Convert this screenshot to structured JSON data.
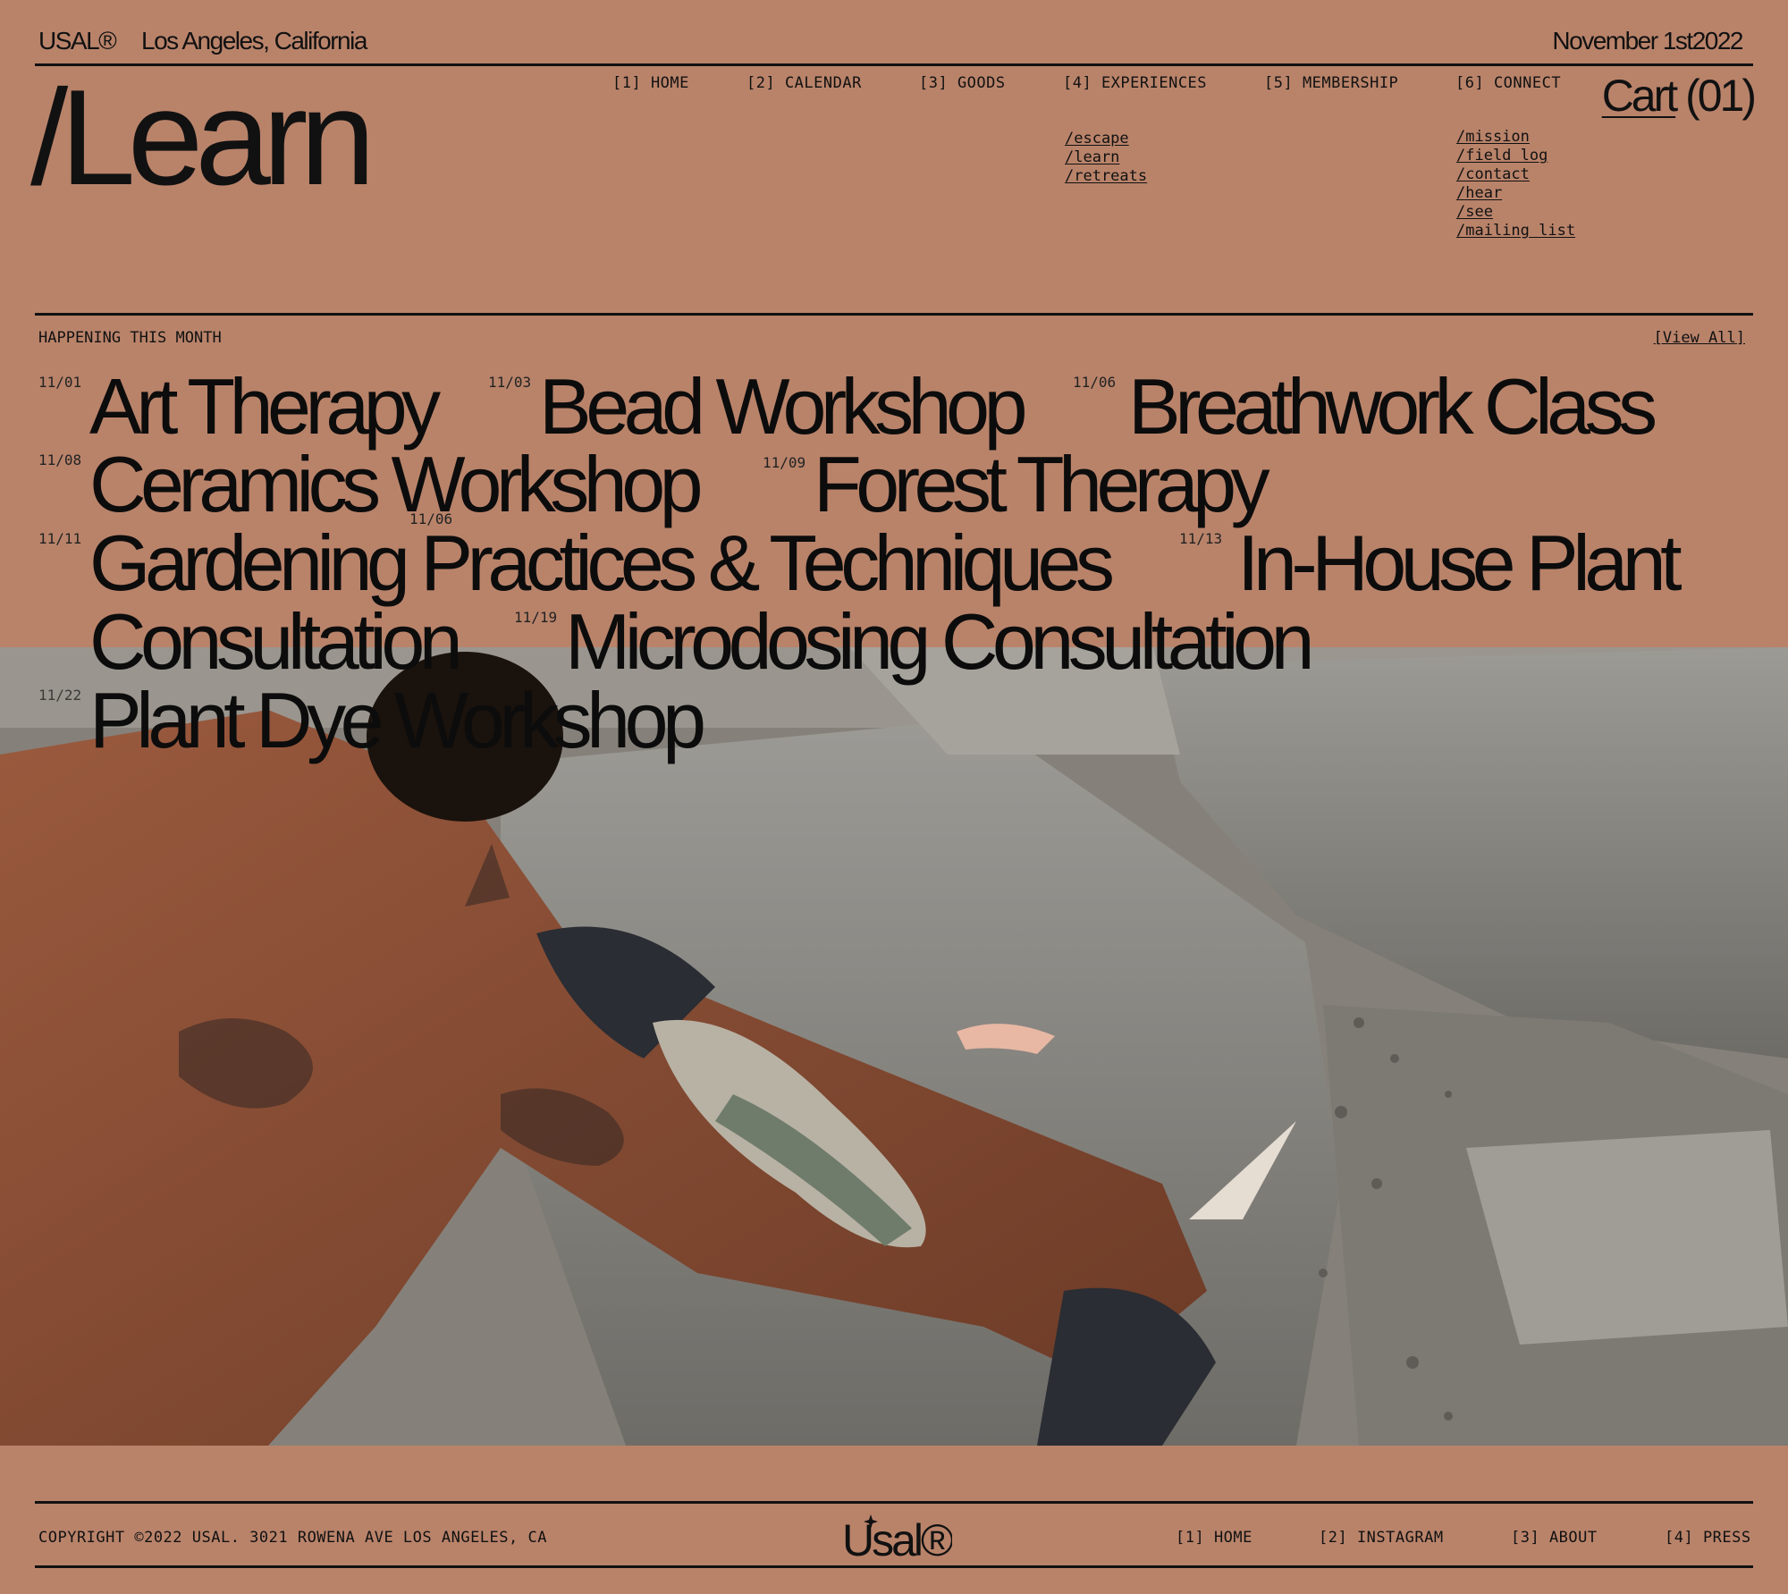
{
  "header": {
    "brand": "USAL®",
    "location": "Los Angeles, California",
    "date": "November 1st2022",
    "page_title": "/Learn",
    "cart_label": "Cart",
    "cart_count": "(01)"
  },
  "nav": [
    {
      "label": "[1] HOME"
    },
    {
      "label": "[2] CALENDAR"
    },
    {
      "label": "[3] GOODS"
    },
    {
      "label": "[4] EXPERIENCES",
      "sub": [
        "/escape",
        "/learn",
        "/retreats"
      ]
    },
    {
      "label": "[5] MEMBERSHIP"
    },
    {
      "label": "[6] CONNECT",
      "sub": [
        "/mission",
        "/field log",
        "/contact",
        "/hear",
        "/see",
        "/mailing list"
      ]
    }
  ],
  "events_section": {
    "heading": "HAPPENING THIS MONTH",
    "view_all": "[View All]",
    "events": [
      {
        "date": "11/01",
        "title": "Art Therapy"
      },
      {
        "date": "11/03",
        "title": "Bead Workshop"
      },
      {
        "date": "11/06",
        "title": "Breathwork Class"
      },
      {
        "date": "11/08",
        "title": "Ceramics Workshop"
      },
      {
        "date": "11/09",
        "title": "Forest Therapy"
      },
      {
        "date": "11/06",
        "title": ""
      },
      {
        "date": "11/11",
        "title": "Gardening Practices & Techniques"
      },
      {
        "date": "11/13",
        "title": "In-House Plant"
      },
      {
        "date": "",
        "title": "Consultation"
      },
      {
        "date": "11/19",
        "title": "Microdosing Consultation"
      },
      {
        "date": "11/22",
        "title": "Plant Dye Workshop"
      }
    ]
  },
  "footer": {
    "copyright": "COPYRIGHT ©2022 USAL. 3021 ROWENA AVE LOS ANGELES, CA",
    "logo_text": "Usal®",
    "links": [
      "[1] HOME",
      "[2] INSTAGRAM",
      "[3] ABOUT",
      "[4] PRESS"
    ]
  },
  "colors": {
    "background": "#b9836a",
    "ink": "#111111"
  }
}
